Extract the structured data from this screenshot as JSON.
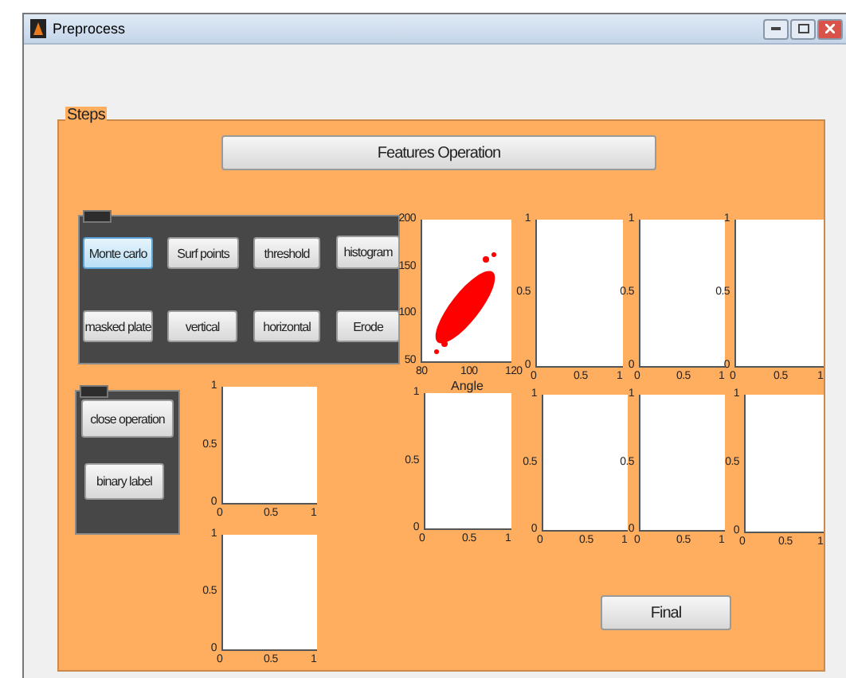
{
  "window": {
    "title": "Preprocess"
  },
  "steps_panel": {
    "title": "Steps",
    "header_button": "Features Operation",
    "group_1": {
      "buttons": [
        {
          "label": "Monte carlo",
          "selected": true
        },
        {
          "label": "Surf points",
          "selected": false
        },
        {
          "label": "threshold",
          "selected": false
        },
        {
          "label": "histogram",
          "selected": false
        },
        {
          "label": "masked plate",
          "selected": false
        },
        {
          "label": "vertical",
          "selected": false
        },
        {
          "label": "horizontal",
          "selected": false
        },
        {
          "label": "Erode",
          "selected": false
        }
      ]
    },
    "group_2": {
      "buttons": [
        {
          "label": "close operation",
          "selected": false
        },
        {
          "label": "binary label",
          "selected": false
        }
      ]
    },
    "plots": [
      {
        "kind": "scatter",
        "xticks": [
          "80",
          "100",
          "120"
        ],
        "yticks": [
          "200",
          "150",
          "100",
          "50"
        ],
        "xlabel": "Angle"
      },
      {
        "kind": "empty",
        "xticks": [
          "0",
          "0.5",
          "1"
        ],
        "yticks": [
          "1",
          "0.5",
          "0"
        ]
      },
      {
        "kind": "empty",
        "xticks": [
          "0",
          "0.5",
          "1"
        ],
        "yticks": [
          "1",
          "0.5",
          "0"
        ]
      },
      {
        "kind": "empty",
        "xticks": [
          "0",
          "0.5",
          "1"
        ],
        "yticks": [
          "1",
          "0.5",
          "0"
        ]
      },
      {
        "kind": "empty",
        "xticks": [
          "0",
          "0.5",
          "1"
        ],
        "yticks": [
          "1",
          "0.5",
          "0"
        ]
      },
      {
        "kind": "empty",
        "xticks": [
          "0",
          "0.5",
          "1"
        ],
        "yticks": [
          "1",
          "0.5",
          "0"
        ]
      },
      {
        "kind": "empty",
        "xticks": [
          "0",
          "0.5",
          "1"
        ],
        "yticks": [
          "1",
          "0.5",
          "0"
        ]
      },
      {
        "kind": "empty",
        "xticks": [
          "0",
          "0.5",
          "1"
        ],
        "yticks": [
          "1",
          "0.5",
          "0"
        ]
      },
      {
        "kind": "empty",
        "xticks": [
          "0",
          "0.5",
          "1"
        ],
        "yticks": [
          "1",
          "0.5",
          "0"
        ]
      },
      {
        "kind": "empty",
        "xticks": [
          "0",
          "0.5",
          "1"
        ],
        "yticks": [
          "1",
          "0.5",
          "0"
        ]
      }
    ],
    "final_button": "Final"
  }
}
